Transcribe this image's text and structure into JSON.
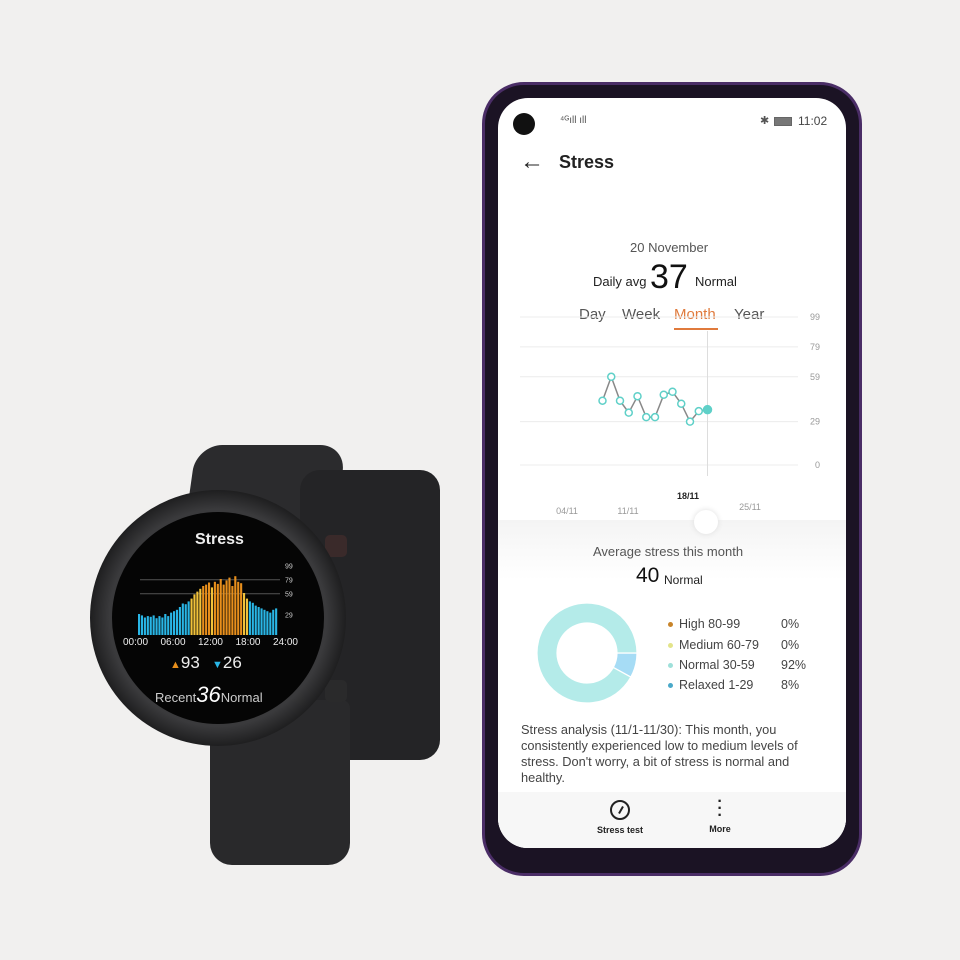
{
  "watch": {
    "title": "Stress",
    "axis_ticks": [
      "99",
      "79",
      "59",
      "29"
    ],
    "time_labels": [
      "00:00",
      "06:00",
      "12:00",
      "18:00",
      "24:00"
    ],
    "max_value": "93",
    "min_value": "26",
    "recent_label": "Recent",
    "recent_value": "36",
    "recent_status": "Normal",
    "bars": [
      30,
      28,
      25,
      27,
      26,
      28,
      24,
      27,
      25,
      30,
      27,
      32,
      34,
      36,
      40,
      45,
      44,
      48,
      52,
      58,
      62,
      66,
      70,
      72,
      75,
      68,
      76,
      73,
      80,
      72,
      78,
      82,
      70,
      84,
      76,
      74,
      60,
      52,
      48,
      46,
      42,
      40,
      38,
      36,
      34,
      32,
      36,
      38
    ],
    "colors": {
      "low": "#29b6e6",
      "mid": "#f2c23a",
      "high": "#e88f1c"
    }
  },
  "status_bar": {
    "time": "11:02"
  },
  "header": {
    "back_icon": "arrow-left-icon",
    "title": "Stress"
  },
  "tabs": [
    {
      "label": "Day",
      "active": false
    },
    {
      "label": "Week",
      "active": false
    },
    {
      "label": "Month",
      "active": true
    },
    {
      "label": "Year",
      "active": false
    }
  ],
  "summary": {
    "date": "20 November",
    "prefix": "Daily avg",
    "value": "37",
    "status": "Normal"
  },
  "chart_data": {
    "type": "line",
    "y_ticks": [
      "99",
      "79",
      "59",
      "29",
      "0"
    ],
    "ylim": [
      0,
      99
    ],
    "x_labels": [
      "04/11",
      "11/11",
      "18/11",
      "25/11"
    ],
    "selected_label": "18/11",
    "x": [
      "08/11",
      "09/11",
      "10/11",
      "11/11",
      "12/11",
      "13/11",
      "14/11",
      "15/11",
      "16/11",
      "17/11",
      "18/11",
      "19/11",
      "20/11"
    ],
    "values": [
      43,
      59,
      43,
      35,
      46,
      32,
      32,
      47,
      49,
      41,
      29,
      36,
      37
    ],
    "grid": true,
    "line_color": "#888888",
    "point_color": "#5fd0c8"
  },
  "month": {
    "title": "Average stress this month",
    "value": "40",
    "status": "Normal",
    "donut": [
      {
        "label": "High 80-99",
        "percent": "0%",
        "value": 0,
        "color": "#c8842a"
      },
      {
        "label": "Medium 60-79",
        "percent": "0%",
        "value": 0,
        "color": "#e3e48a"
      },
      {
        "label": "Normal 30-59",
        "percent": "92%",
        "value": 92,
        "color": "#b4ebe9"
      },
      {
        "label": "Relaxed 1-29",
        "percent": "8%",
        "value": 8,
        "color": "#a6dcf5"
      }
    ]
  },
  "analysis": "Stress analysis (11/1-11/30): This month, you consistently experienced low to medium levels of stress. Don't worry, a bit of stress is normal and healthy.",
  "bottom_nav": [
    {
      "label": "Stress test",
      "icon": "gauge-icon"
    },
    {
      "label": "More",
      "icon": "more-vertical-icon"
    }
  ]
}
